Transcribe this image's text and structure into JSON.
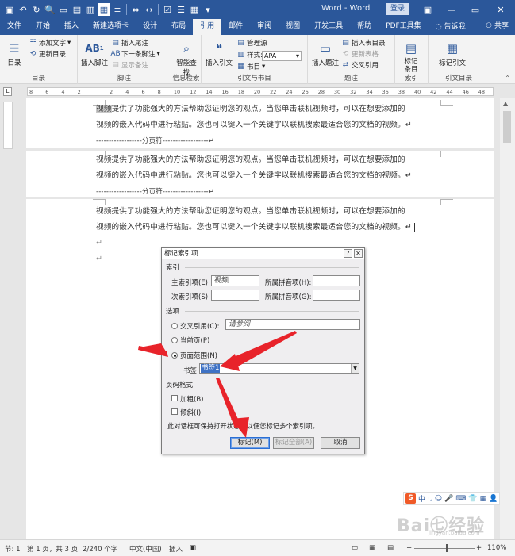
{
  "window": {
    "title": "Word - Word",
    "login_label": "登录",
    "controls": {
      "minimize": "—",
      "restore": "▭",
      "close": "✕"
    }
  },
  "quick_access": {
    "icons": [
      "save-icon",
      "undo-icon",
      "redo-icon",
      "preview-icon",
      "new-icon",
      "open-icon",
      "form-icon",
      "layout-icon",
      "check-icon",
      "list-icon"
    ]
  },
  "tabs": [
    {
      "label": "文件"
    },
    {
      "label": "开始"
    },
    {
      "label": "插入"
    },
    {
      "label": "新建选项卡"
    },
    {
      "label": "设计"
    },
    {
      "label": "布局"
    },
    {
      "label": "引用",
      "active": true
    },
    {
      "label": "邮件"
    },
    {
      "label": "审阅"
    },
    {
      "label": "视图"
    },
    {
      "label": "开发工具"
    },
    {
      "label": "帮助"
    },
    {
      "label": "PDF工具集"
    },
    {
      "label": "告诉我"
    }
  ],
  "share_label": "共享",
  "ribbon": {
    "groups": {
      "toc": {
        "label": "目录",
        "big": "目录",
        "items": [
          "添加文字",
          "更新目录"
        ]
      },
      "footnotes": {
        "label": "脚注",
        "big": "插入脚注",
        "big_icon_text": "AB",
        "big_icon_sup": "1",
        "items": [
          "插入尾注",
          "下一条脚注",
          "显示备注"
        ]
      },
      "research": {
        "label": "信息检索",
        "big": "智能查找"
      },
      "citations": {
        "label": "引文与书目",
        "big": "插入引文",
        "items": [
          "管理源",
          "样式:",
          "书目"
        ],
        "style_value": "APA"
      },
      "captions": {
        "label": "题注",
        "big": "插入题注",
        "items": [
          "插入表目录",
          "更新表格",
          "交叉引用"
        ]
      },
      "index": {
        "label": "索引",
        "big": "标记条目"
      },
      "toa": {
        "label": "引文目录",
        "big": "标记引文"
      }
    }
  },
  "ruler": {
    "ticks": [
      "8",
      "6",
      "4",
      "2",
      "",
      "2",
      "4",
      "6",
      "8",
      "10",
      "12",
      "14",
      "16",
      "18",
      "20",
      "22",
      "24",
      "26",
      "28",
      "30",
      "32",
      "34",
      "36",
      "38",
      "40",
      "42",
      "44",
      "46",
      "48"
    ]
  },
  "document": {
    "pages": [
      {
        "lines": [
          "视频提供了功能强大的方法帮助您证明您的观点。当您单击联机视频时，可以在想要添加的",
          "视频的嵌入代码中进行粘贴。您也可以键入一个关键字以联机搜索最适合您的文档的视频。↵"
        ],
        "highlight": "视频",
        "page_break": "------------------分页符------------------↵"
      },
      {
        "lines": [
          "视频提供了功能强大的方法帮助您证明您的观点。当您单击联机视频时，可以在想要添加的",
          "视频的嵌入代码中进行粘贴。您也可以键入一个关键字以联机搜索最适合您的文档的视频。↵"
        ],
        "page_break": "------------------分页符------------------↵"
      },
      {
        "lines": [
          "视频提供了功能强大的方法帮助您证明您的观点。当您单击联机视频时，可以在想要添加的",
          "视频的嵌入代码中进行粘贴。您也可以键入一个关键字以联机搜索最适合您的文档的视频。↵"
        ],
        "extra_marks": [
          "↵",
          "↵"
        ]
      }
    ]
  },
  "dialog": {
    "title": "标记索引项",
    "help_btn": "?",
    "close_btn": "✕",
    "index_section": "索引",
    "main_entry_label": "主索引项(E):",
    "main_entry_value": "视频",
    "main_pinyin_label": "所属拼音项(H):",
    "main_pinyin_value": "",
    "sub_entry_label": "次索引项(S):",
    "sub_entry_value": "",
    "sub_pinyin_label": "所属拼音项(G):",
    "sub_pinyin_value": "",
    "options_section": "选项",
    "cross_ref_label": "交叉引用(C):",
    "cross_ref_value": "请参阅",
    "current_page_label": "当前页(P)",
    "page_range_label": "页面范围(N)",
    "bookmark_label": "书签:",
    "bookmark_value": "书签1",
    "page_format_section": "页码格式",
    "bold_label": "加粗(B)",
    "italic_label": "倾斜(I)",
    "note": "此对话框可保持打开状态，以便您标记多个索引项。",
    "mark_btn": "标记(M)",
    "mark_all_btn": "标记全部(A)",
    "cancel_btn": "取消"
  },
  "sogou": {
    "logo": "S",
    "items": [
      "中",
      "·,",
      "☺",
      "🎤",
      "⌨",
      "👕",
      "▦",
      "👤"
    ]
  },
  "watermark": {
    "text": "Bai㊆经验",
    "sub": "jingyan.baidu.com"
  },
  "status_bar": {
    "section": "节: 1",
    "page": "第 1 页，共 3 页",
    "words": "2/240 个字",
    "language": "中文(中国)",
    "mode": "插入",
    "zoom": "110%"
  },
  "colors": {
    "title_bar": "#2b579a",
    "ribbon": "#f3f3f3",
    "arrow": "#e8232a"
  }
}
